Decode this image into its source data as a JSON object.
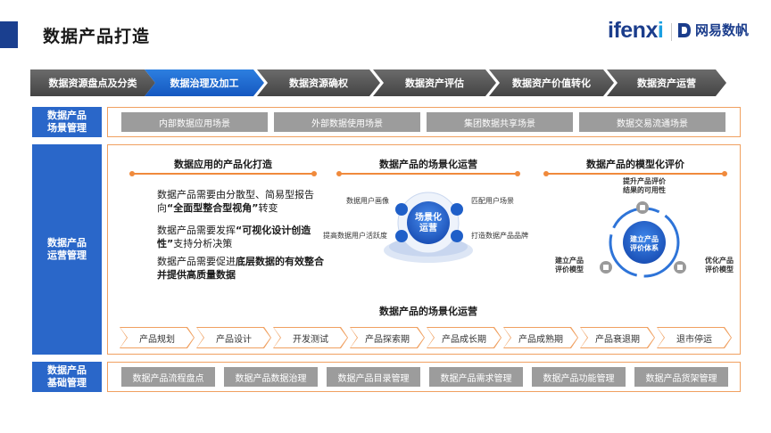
{
  "header": {
    "title": "数据产品打造",
    "logo_ifenxi_main": "ifenx",
    "logo_ifenxi_dot": "i",
    "logo_wy_text": "网易数帆"
  },
  "flow_steps": [
    "数据资源盘点及分类",
    "数据治理及加工",
    "数据资源确权",
    "数据资产评估",
    "数据资产价值转化",
    "数据资产运营"
  ],
  "scene_row": {
    "label": "数据产品\n场景管理",
    "items": [
      "内部数据应用场景",
      "外部数据使用场景",
      "集团数据共享场景",
      "数据交易流通场景"
    ]
  },
  "ops_row": {
    "label": "数据产品\n运营管理",
    "col1": {
      "title": "数据应用的产品化打造",
      "p1_a": "数据产品需要由分散型、简易型报告向",
      "p1_b": "“全面型整合型视角”",
      "p1_c": "转变",
      "p2_a": "数据产品需要发挥",
      "p2_b": "“可视化设计创造性”",
      "p2_c": "支持分析决策",
      "p3_a": "数据产品需要促进",
      "p3_b": "底层数据的有效整合并提供高质量数据"
    },
    "col2": {
      "title": "数据产品的场景化运营",
      "center": "场景化\n运营",
      "tl": "数据用户画像",
      "tr": "匹配用户场景",
      "bl": "提高数据用户活跃度",
      "br": "打造数据产品品牌"
    },
    "col3": {
      "title": "数据产品的模型化评价",
      "center": "建立产品\n评价体系",
      "top": "提升产品评价\n结果的可用性",
      "left": "建立产品\n评价模型",
      "right": "优化产品\n评价模型"
    },
    "lifecycle_title": "数据产品的场景化运营",
    "lifecycle": [
      "产品规划",
      "产品设计",
      "开发测试",
      "产品探索期",
      "产品成长期",
      "产品成熟期",
      "产品衰退期",
      "退市停运"
    ]
  },
  "base_row": {
    "label": "数据产品\n基础管理",
    "items": [
      "数据产品流程盘点",
      "数据产品数据治理",
      "数据产品目录管理",
      "数据产品需求管理",
      "数据产品功能管理",
      "数据产品货架管理"
    ]
  },
  "colors": {
    "accent": "#1a3f8f",
    "label_blue": "#2a67c9",
    "orange": "#f08a3c",
    "active_step": "#1f6bd6"
  },
  "icons": [
    "shield-icon",
    "chart-icon",
    "gear-icon",
    "box-icon",
    "lock-icon",
    "image-icon",
    "linkedin-icon"
  ]
}
